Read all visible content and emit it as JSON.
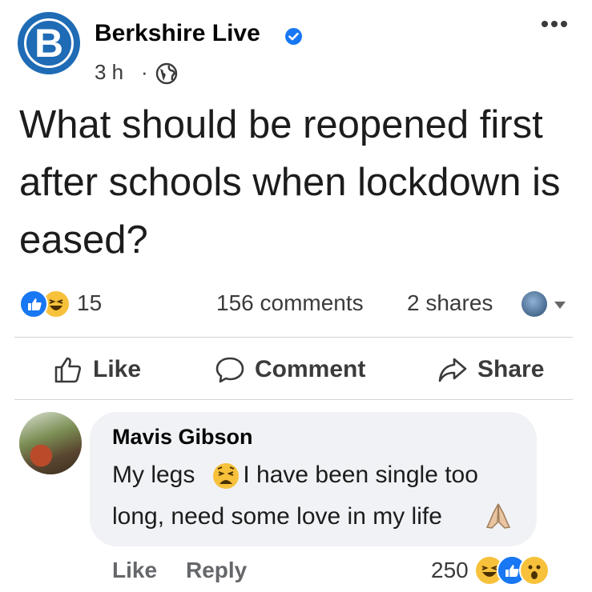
{
  "post": {
    "page_name": "Berkshire Live",
    "avatar_letter": "B",
    "time": "3 h",
    "separator": "·",
    "text": "What should be reopened first after schools when lockdown is eased?"
  },
  "stats": {
    "reactions_count": "15",
    "comments": "156 comments",
    "shares": "2 shares"
  },
  "actions": {
    "like": "Like",
    "comment": "Comment",
    "share": "Share"
  },
  "comment": {
    "author": "Mavis Gibson",
    "line1_part1": "My legs",
    "line1_part2": "I have been single too",
    "line2": "long, need some love in my life",
    "like_label": "Like",
    "reply_label": "Reply",
    "reaction_count": "250"
  },
  "icons": {
    "verified": "verified-badge-icon",
    "privacy": "globe-icon",
    "more": "more-options-icon",
    "like": "thumbs-up-icon",
    "comment": "speech-bubble-icon",
    "share": "share-arrow-icon"
  },
  "colors": {
    "brand_blue": "#1877f2",
    "avatar_blue": "#1f6bb5",
    "bubble_bg": "#f0f2f5"
  }
}
